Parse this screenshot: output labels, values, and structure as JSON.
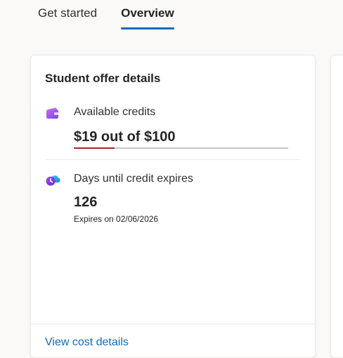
{
  "tabs": [
    {
      "label": "Get started",
      "active": false
    },
    {
      "label": "Overview",
      "active": true
    }
  ],
  "card": {
    "title": "Student offer details",
    "credits": {
      "label": "Available credits",
      "value_text": "$19 out of $100",
      "progress_fraction": 0.19,
      "icon": "wallet-card-icon"
    },
    "expiry": {
      "label": "Days until credit expires",
      "days": "126",
      "expires_text": "Expires on 02/06/2026",
      "icon": "cloud-clock-icon"
    },
    "footer_link": "View cost details"
  },
  "colors": {
    "accent": "#0f6cbd",
    "progress": "#a4262c",
    "icon_purple": "#8a3ffc"
  }
}
